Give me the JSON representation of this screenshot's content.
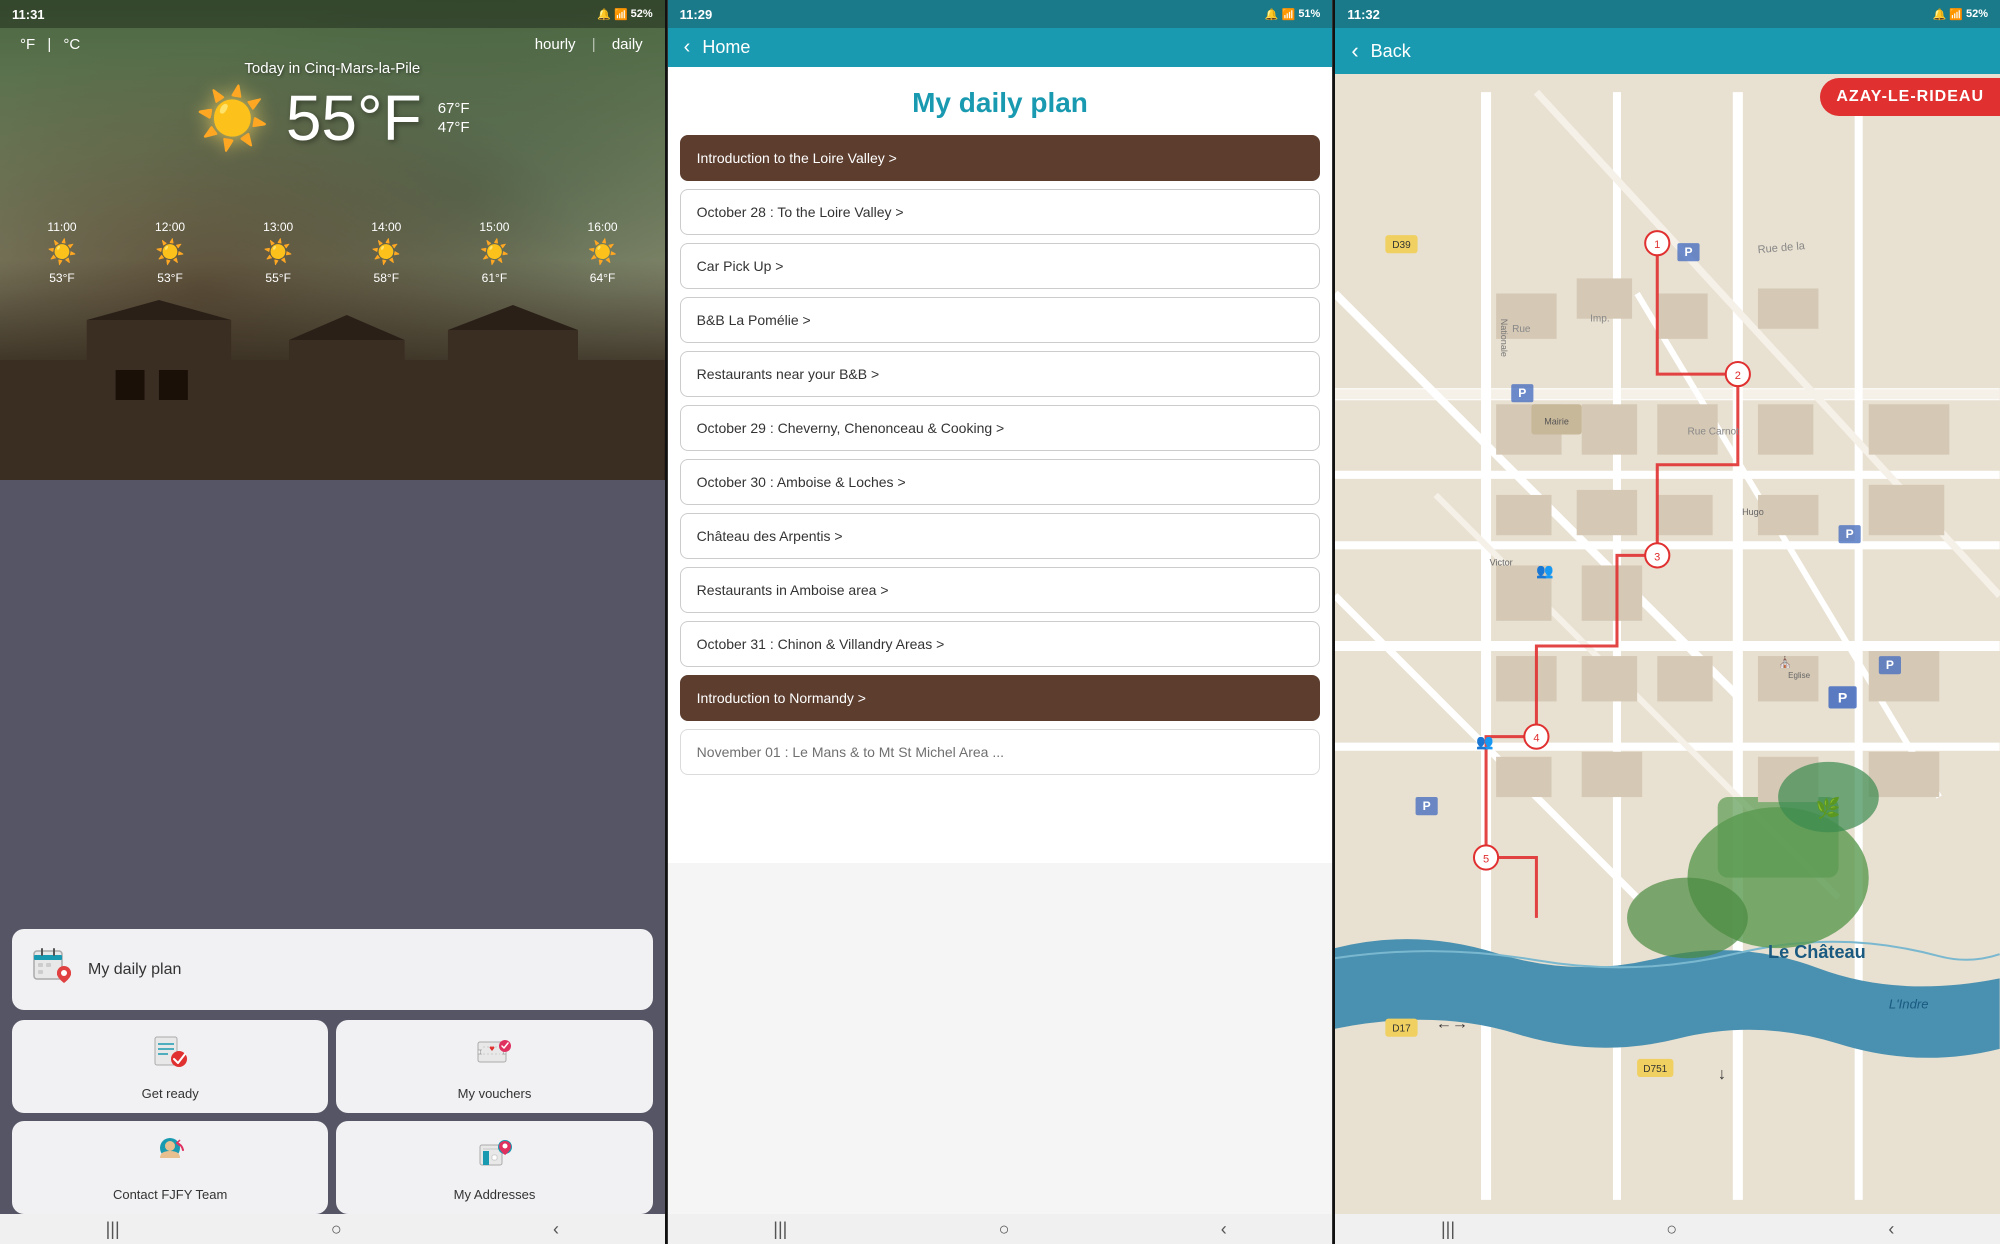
{
  "panel1": {
    "status_time": "11:31",
    "status_battery": "52%",
    "temp_unit_f": "°F",
    "temp_unit_c": "°C",
    "view_hourly": "hourly",
    "view_daily": "daily",
    "location": "Today in Cinq-Mars-la-Pile",
    "main_temp": "55°F",
    "high_temp": "67°F",
    "low_temp": "47°F",
    "hourly": [
      {
        "time": "11:00",
        "temp": "53°F"
      },
      {
        "time": "12:00",
        "temp": "53°F"
      },
      {
        "time": "13:00",
        "temp": "55°F"
      },
      {
        "time": "14:00",
        "temp": "58°F"
      },
      {
        "time": "15:00",
        "temp": "61°F"
      },
      {
        "time": "16:00",
        "temp": "64°F"
      }
    ],
    "menu": {
      "daily_plan": {
        "label": "My daily plan",
        "icon": "📅"
      },
      "get_ready": {
        "label": "Get ready",
        "icon": "📋"
      },
      "my_vouchers": {
        "label": "My vouchers",
        "icon": "🎫"
      },
      "contact_team": {
        "label": "Contact FJFY Team",
        "icon": "👩"
      },
      "my_addresses": {
        "label": "My Addresses",
        "icon": "📍"
      }
    }
  },
  "panel2": {
    "status_time": "11:29",
    "status_battery": "51%",
    "header_back": "‹",
    "header_title": "Home",
    "plan_title": "My daily plan",
    "items": [
      {
        "label": "Introduction to the Loire Valley >",
        "style": "dark"
      },
      {
        "label": "October 28 : To the Loire Valley >",
        "style": "normal"
      },
      {
        "label": "Car Pick Up >",
        "style": "normal"
      },
      {
        "label": "B&B La Pomélie >",
        "style": "normal"
      },
      {
        "label": "Restaurants near your B&B >",
        "style": "normal"
      },
      {
        "label": "October 29 : Cheverny, Chenonceau & Cooking >",
        "style": "normal"
      },
      {
        "label": "October 30 : Amboise & Loches >",
        "style": "normal"
      },
      {
        "label": "Château des Arpentis >",
        "style": "normal"
      },
      {
        "label": "Restaurants in Amboise area >",
        "style": "normal"
      },
      {
        "label": "October 31 : Chinon & Villandry Areas >",
        "style": "normal"
      },
      {
        "label": "Introduction to Normandy >",
        "style": "dark"
      },
      {
        "label": "November 01 : Le Mans & to Mt St Michel Area ...",
        "style": "normal"
      }
    ]
  },
  "panel3": {
    "status_time": "11:32",
    "status_battery": "52%",
    "header_back": "‹",
    "header_title": "Back",
    "map_label": "AZAY-LE-RIDEAU"
  }
}
